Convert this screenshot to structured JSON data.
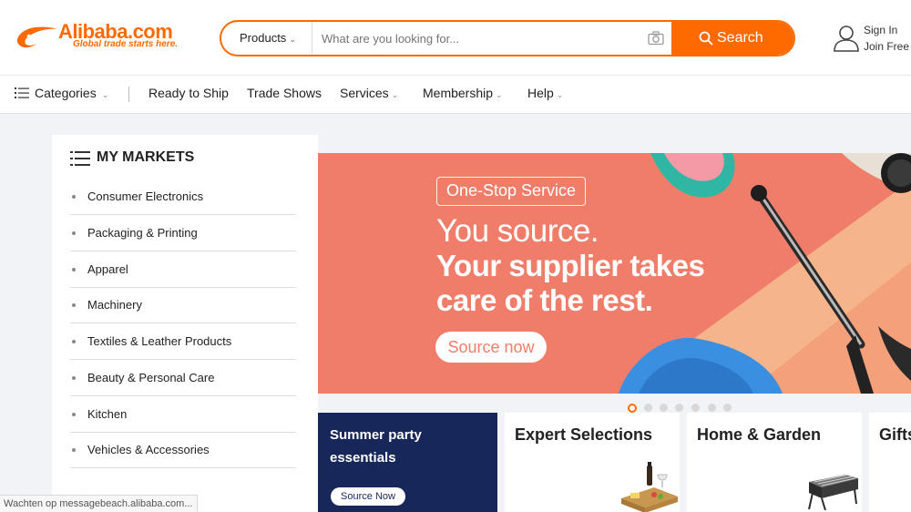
{
  "header": {
    "logo_text": "Alibaba.com",
    "logo_tagline": "Global trade starts here.",
    "search": {
      "category": "Products",
      "placeholder": "What are you looking for...",
      "button": "Search"
    },
    "user": {
      "sign_in": "Sign In",
      "join_free": "Join Free"
    }
  },
  "nav": {
    "categories": "Categories",
    "items": [
      "Ready to Ship",
      "Trade Shows",
      "Services",
      "Membership",
      "Help"
    ]
  },
  "markets": {
    "title": "MY MARKETS",
    "items": [
      "Consumer Electronics",
      "Packaging & Printing",
      "Apparel",
      "Machinery",
      "Textiles & Leather Products",
      "Beauty & Personal Care",
      "Kitchen",
      "Vehicles & Accessories"
    ]
  },
  "banner": {
    "chip": "One-Stop Service",
    "line1": "You source.",
    "line2": "Your supplier takes",
    "line3": "care of the rest.",
    "cta": "Source now",
    "slide_count": 7,
    "active_slide": 1
  },
  "cards": {
    "promo_line1": "Summer party",
    "promo_line2": "essentials",
    "promo_cta": "Source Now",
    "expert": "Expert Selections",
    "home": "Home & Garden",
    "gifts": "Gifts"
  },
  "status_bar": "Wachten op messagebeach.alibaba.com...",
  "colors": {
    "accent": "#ff6a00",
    "banner": "#f07d6a",
    "navy": "#18275a"
  }
}
